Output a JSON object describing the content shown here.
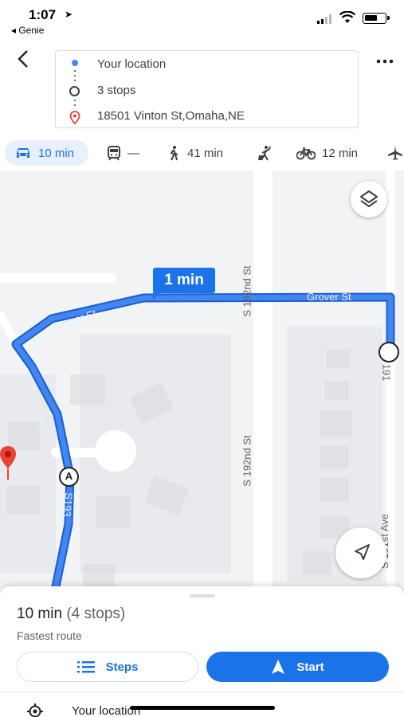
{
  "status_bar": {
    "time": "1:07",
    "back_app": "◂ Genie"
  },
  "route": {
    "origin": "Your location",
    "stops": "3 stops",
    "destination": "18501 Vinton St,Omaha,NE"
  },
  "modes": [
    {
      "icon": "car-icon",
      "label": "10 min",
      "active": true
    },
    {
      "icon": "transit-icon",
      "label": "—"
    },
    {
      "icon": "walk-icon",
      "label": "41 min"
    },
    {
      "icon": "rideshare-icon",
      "label": ""
    },
    {
      "icon": "bike-icon",
      "label": "12 min"
    },
    {
      "icon": "flight-icon",
      "label": ""
    }
  ],
  "map": {
    "labels": {
      "grover_left": "Grover St",
      "grover_right": "Grover St",
      "s192_top": "S 192nd St",
      "s192_bottom": "S 192nd St",
      "s193": "S 193rd St",
      "s193_lower": "S193",
      "s191": "S 191",
      "s191_ave": "S 191st Ave"
    },
    "time_bubble": "1 min",
    "waypoint_label": "A",
    "route_color": "#4285f4"
  },
  "sheet": {
    "duration": "10 min",
    "stops": "(4 stops)",
    "subtitle": "Fastest route",
    "steps_label": "Steps",
    "start_label": "Start",
    "next_row": "Your location"
  },
  "colors": {
    "accent": "#1a73e8",
    "pin": "#ea4335"
  }
}
